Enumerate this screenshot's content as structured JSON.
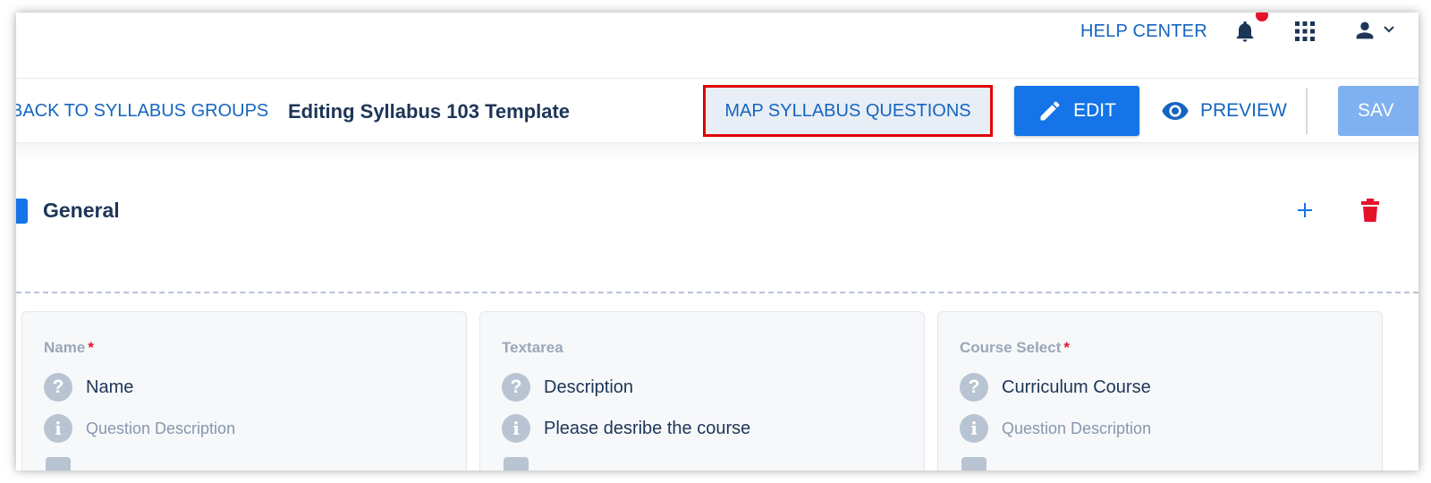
{
  "header": {
    "help_center": "HELP CENTER",
    "notifications_icon": "bell-icon",
    "apps_icon": "grid-icon",
    "account_icon": "user-icon"
  },
  "toolbar": {
    "back_label": "BACK TO SYLLABUS GROUPS",
    "title": "Editing Syllabus 103 Template",
    "map_label": "MAP SYLLABUS QUESTIONS",
    "edit_label": "EDIT",
    "preview_label": "PREVIEW",
    "save_label": "SAV"
  },
  "section": {
    "title": "General",
    "add_icon": "plus-icon",
    "delete_icon": "trash-icon"
  },
  "cards": [
    {
      "label": "Name",
      "required": true,
      "question": "Name",
      "description": "Question Description",
      "description_is_placeholder": true
    },
    {
      "label": "Textarea",
      "required": false,
      "question": "Description",
      "description": "Please desribe the course",
      "description_is_placeholder": false
    },
    {
      "label": "Course Select",
      "required": true,
      "question": "Curriculum Course",
      "description": "Question Description",
      "description_is_placeholder": true
    }
  ],
  "colors": {
    "primary": "#1474e8",
    "link": "#1565c0",
    "highlight_border": "#e00000",
    "danger": "#e5132a",
    "heading": "#1d3557",
    "muted": "#9aa7b8"
  }
}
